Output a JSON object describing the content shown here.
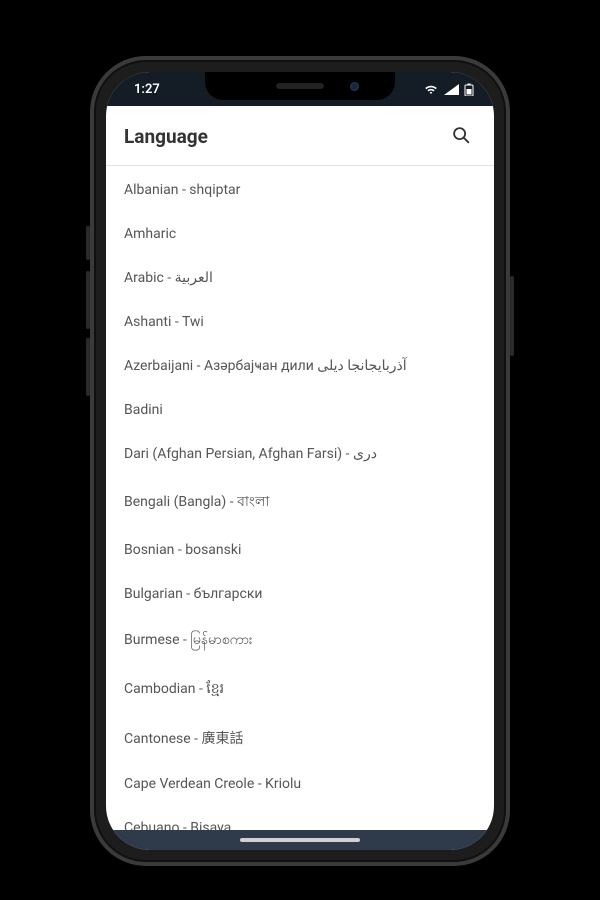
{
  "status": {
    "time": "1:27"
  },
  "header": {
    "title": "Language"
  },
  "languages": [
    {
      "label": "Albanian - shqiptar"
    },
    {
      "label": "Amharic"
    },
    {
      "label": "Arabic - العربية"
    },
    {
      "label": "Ashanti - Twi"
    },
    {
      "label": "Azerbaijani - Азәрбајҹан дили آذربایجانجا دیلی"
    },
    {
      "label": "Badini"
    },
    {
      "label": "Dari (Afghan Persian, Afghan Farsi) - درى"
    },
    {
      "label": "Bengali (Bangla) - বাংলা"
    },
    {
      "label": "Bosnian - bosanski"
    },
    {
      "label": "Bulgarian - български"
    },
    {
      "label": "Burmese - မြန်မာစကား"
    },
    {
      "label": "Cambodian - ខ្មែរ"
    },
    {
      "label": "Cantonese - 廣東話"
    },
    {
      "label": "Cape Verdean Creole - Kriolu"
    },
    {
      "label": "Cebuano - Bisaya"
    }
  ]
}
